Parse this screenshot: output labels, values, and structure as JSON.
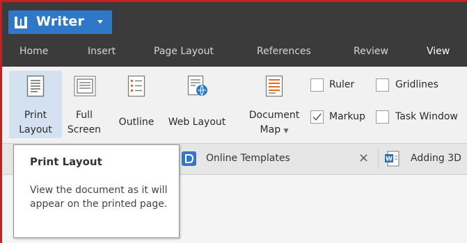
{
  "app": {
    "title": "Writer"
  },
  "menu_tabs": [
    "Home",
    "Insert",
    "Page Layout",
    "References",
    "Review",
    "View"
  ],
  "active_tab": "View",
  "ribbon": {
    "print_layout": {
      "line1": "Print",
      "line2": "Layout"
    },
    "full_screen": {
      "line1": "Full",
      "line2": "Screen"
    },
    "outline": {
      "label": "Outline"
    },
    "web_layout": {
      "label": "Web Layout"
    },
    "document_map": {
      "line1": "Document",
      "line2": "Map"
    },
    "checkboxes": [
      {
        "label": "Ruler",
        "checked": false
      },
      {
        "label": "Gridlines",
        "checked": false
      },
      {
        "label": "Markup",
        "checked": true
      },
      {
        "label": "Task Window",
        "checked": false
      }
    ]
  },
  "document_tabs": [
    {
      "label": "Online Templates",
      "close": "×"
    },
    {
      "label": "Adding 3D"
    }
  ],
  "tooltip": {
    "title": "Print Layout",
    "body": "View the document as it will appear on the printed page."
  },
  "colors": {
    "brand": "#2f78c8",
    "ribbon_selected": "#d3e1f1",
    "titlebar": "#3b3b3b"
  }
}
